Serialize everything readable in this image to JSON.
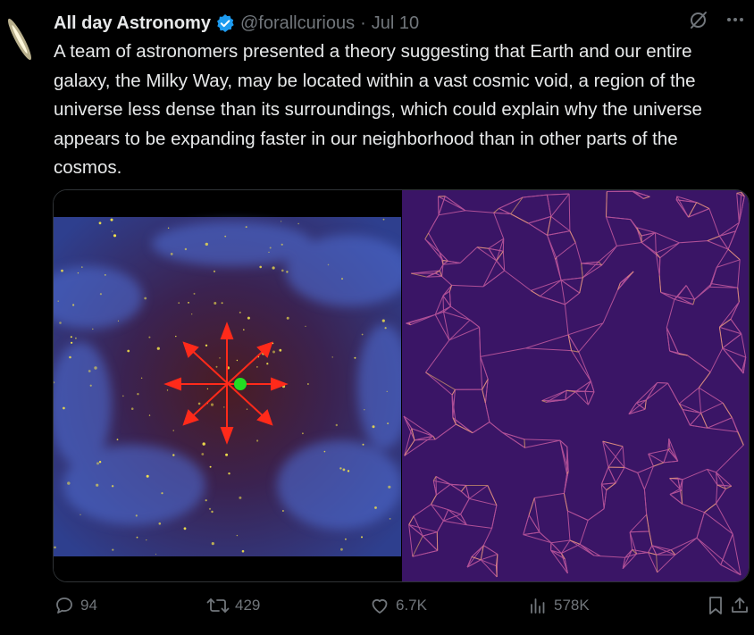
{
  "tweet": {
    "author_name": "All day Astronomy",
    "handle": "@forallcurious",
    "separator": "·",
    "date": "Jul 10",
    "text": "A team of astronomers presented a theory suggesting that Earth and our entire galaxy, the Milky Way, may be located within a vast cosmic void, a region of the universe less dense than its surroundings, which could explain why the universe appears to be expanding faster in our neighborhood than in other parts of the cosmos."
  },
  "icons": {
    "verified": "verified-badge-icon",
    "grok": "grok-icon",
    "more": "more-icon",
    "reply": "reply-icon",
    "repost": "repost-icon",
    "like": "like-icon",
    "views": "views-icon",
    "bookmark": "bookmark-icon",
    "share": "share-icon"
  },
  "actions": {
    "replies": "94",
    "reposts": "429",
    "likes": "6.7K",
    "views": "578K"
  },
  "colors": {
    "background": "#000000",
    "text": "#e7e9ea",
    "muted": "#71767b",
    "verified": "#1d9bf0",
    "arrow": "#ff2a1a",
    "earth_marker": "#22dd22"
  }
}
